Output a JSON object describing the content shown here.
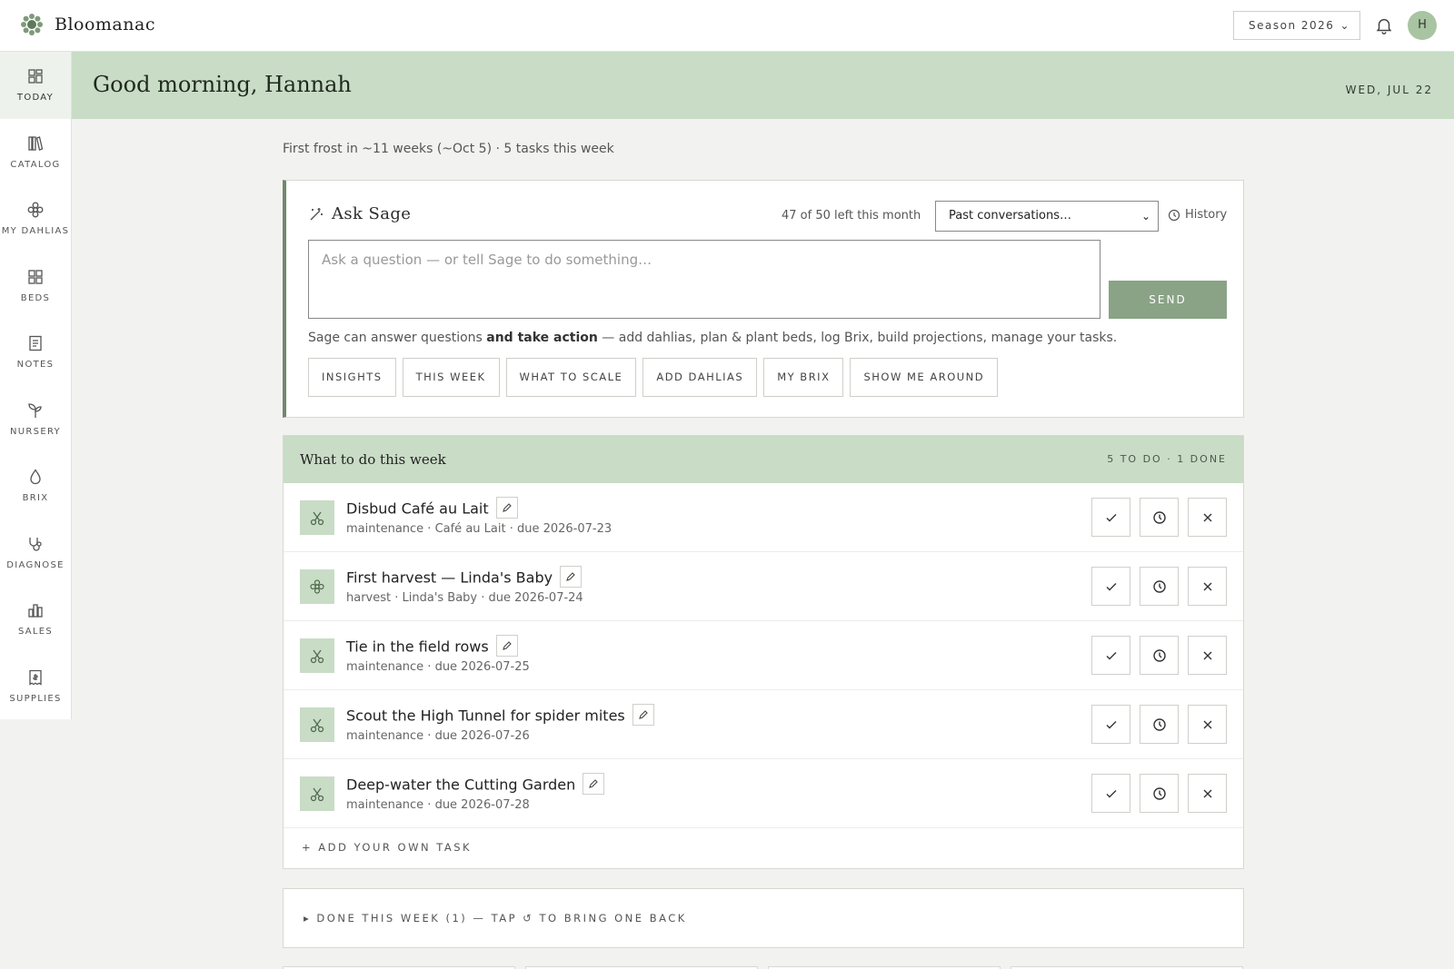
{
  "app": {
    "name": "Bloomanac"
  },
  "header": {
    "season_label": "Season 2026",
    "avatar_initial": "H",
    "bell_icon": "bell-icon"
  },
  "sidebar": {
    "items": [
      {
        "label": "TODAY",
        "icon": "grid-icon",
        "active": true
      },
      {
        "label": "CATALOG",
        "icon": "books-icon"
      },
      {
        "label": "MY DAHLIAS",
        "icon": "flower-icon"
      },
      {
        "label": "BEDS",
        "icon": "beds-grid-icon"
      },
      {
        "label": "NOTES",
        "icon": "note-icon"
      },
      {
        "label": "NURSERY",
        "icon": "sprout-icon"
      },
      {
        "label": "BRIX",
        "icon": "drop-icon"
      },
      {
        "label": "DIAGNOSE",
        "icon": "stethoscope-icon"
      },
      {
        "label": "SALES",
        "icon": "bar-chart-icon"
      },
      {
        "label": "SUPPLIES",
        "icon": "receipt-icon"
      }
    ]
  },
  "greeting": {
    "title": "Good morning, Hannah",
    "date": "WED, JUL 22"
  },
  "frost_line": "First frost in ~11 weeks (~Oct 5) · 5 tasks this week",
  "sage": {
    "title": "Ask Sage",
    "quota": "47 of 50 left this month",
    "conversations_placeholder": "Past conversations…",
    "history_label": "History",
    "input_placeholder": "Ask a question — or tell Sage to do something…",
    "send_label": "SEND",
    "desc_before": "Sage can answer questions ",
    "desc_bold": "and take action",
    "desc_after": " — add dahlias, plan & plant beds, log Brix, build projections, manage your tasks.",
    "chips": [
      "INSIGHTS",
      "THIS WEEK",
      "WHAT TO SCALE",
      "ADD DAHLIAS",
      "MY BRIX",
      "SHOW ME AROUND"
    ]
  },
  "tasks": {
    "title": "What to do this week",
    "count": "5 TO DO · 1 DONE",
    "items": [
      {
        "title": "Disbud Café au Lait",
        "meta": "maintenance · Café au Lait · due 2026-07-23",
        "icon": "scissors-icon"
      },
      {
        "title": "First harvest — Linda's Baby",
        "meta": "harvest · Linda's Baby · due 2026-07-24",
        "icon": "flower-icon"
      },
      {
        "title": "Tie in the field rows",
        "meta": "maintenance · due 2026-07-25",
        "icon": "scissors-icon"
      },
      {
        "title": "Scout the High Tunnel for spider mites",
        "meta": "maintenance · due 2026-07-26",
        "icon": "scissors-icon"
      },
      {
        "title": "Deep-water the Cutting Garden",
        "meta": "maintenance · due 2026-07-28",
        "icon": "scissors-icon"
      }
    ],
    "add_label": "+ ADD YOUR OWN TASK"
  },
  "done_section": {
    "label": "▸ DONE THIS WEEK (1) — TAP ↺ TO BRING ONE BACK"
  },
  "colors": {
    "accent": "#c9dcc6",
    "send": "#8aa386",
    "sage_border": "#6e8a6b"
  }
}
